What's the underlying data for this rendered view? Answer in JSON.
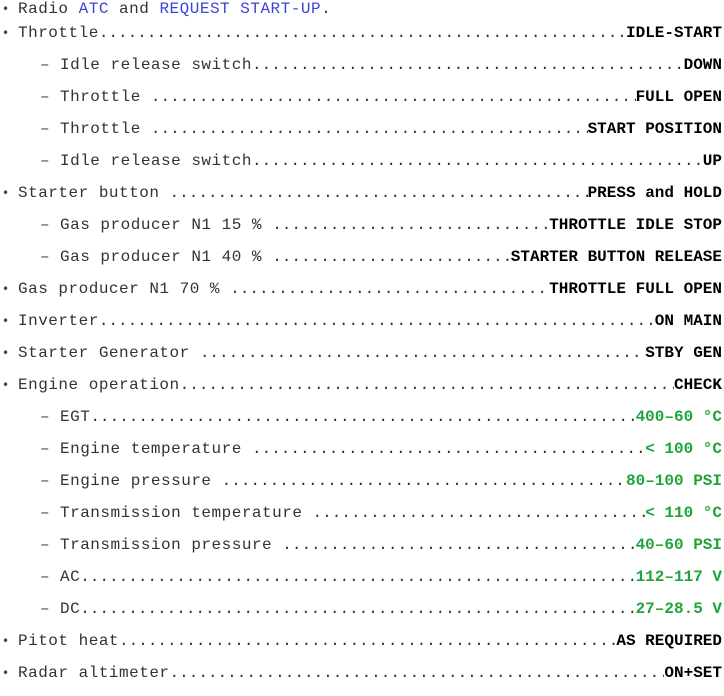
{
  "intro": {
    "text_before": "Radio ",
    "atc": "ATC",
    "and": " and ",
    "request": "REQUEST START-UP",
    "period": "."
  },
  "items": [
    {
      "level": 1,
      "label": "Throttle",
      "value": "IDLE-START",
      "value_color": "black"
    },
    {
      "level": 2,
      "label": "Idle release switch",
      "value": "DOWN",
      "value_color": "black"
    },
    {
      "level": 2,
      "label": "Throttle ",
      "value": "FULL OPEN",
      "value_color": "black"
    },
    {
      "level": 2,
      "label": "Throttle ",
      "value": "START POSITION",
      "value_color": "black"
    },
    {
      "level": 2,
      "label": "Idle release switch",
      "value": "UP",
      "value_color": "black"
    },
    {
      "level": 1,
      "label": "Starter button ",
      "value": "PRESS and HOLD",
      "value_color": "black"
    },
    {
      "level": 2,
      "label": "Gas producer N1 15 % ",
      "value": "THROTTLE IDLE STOP",
      "value_color": "black"
    },
    {
      "level": 2,
      "label": "Gas producer N1 40 % ",
      "value": "STARTER BUTTON RELEASE",
      "value_color": "black"
    },
    {
      "level": 1,
      "label": "Gas producer N1 70 % ",
      "value": "THROTTLE FULL OPEN",
      "value_color": "black"
    },
    {
      "level": 1,
      "label": "Inverter",
      "value": "ON MAIN",
      "value_color": "black"
    },
    {
      "level": 1,
      "label": "Starter Generator ",
      "value": "STBY GEN",
      "value_color": "black"
    },
    {
      "level": 1,
      "label": "Engine operation",
      "value": "CHECK",
      "value_color": "black"
    },
    {
      "level": 2,
      "label": "EGT",
      "value": "400–60 °C",
      "value_color": "green"
    },
    {
      "level": 2,
      "label": "Engine temperature ",
      "value": "< 100 °C",
      "value_color": "green"
    },
    {
      "level": 2,
      "label": "Engine pressure ",
      "value": "80–100 PSI",
      "value_color": "green"
    },
    {
      "level": 2,
      "label": "Transmission temperature ",
      "value": "< 110 °C",
      "value_color": "green"
    },
    {
      "level": 2,
      "label": "Transmission pressure ",
      "value": "40–60 PSI",
      "value_color": "green"
    },
    {
      "level": 2,
      "label": "AC",
      "value": "112–117 V",
      "value_color": "green"
    },
    {
      "level": 2,
      "label": "DC",
      "value": "27–28.5 V",
      "value_color": "green"
    },
    {
      "level": 1,
      "label": "Pitot heat",
      "value": "AS REQUIRED",
      "value_color": "black"
    },
    {
      "level": 1,
      "label": "Radar altimeter",
      "value": "ON+SET",
      "value_color": "black"
    }
  ],
  "colors": {
    "link_blue": "#3a43d8",
    "value_green": "#22a33a",
    "text": "#222222"
  },
  "symbols": {
    "bullet": "•",
    "dash": "–"
  }
}
